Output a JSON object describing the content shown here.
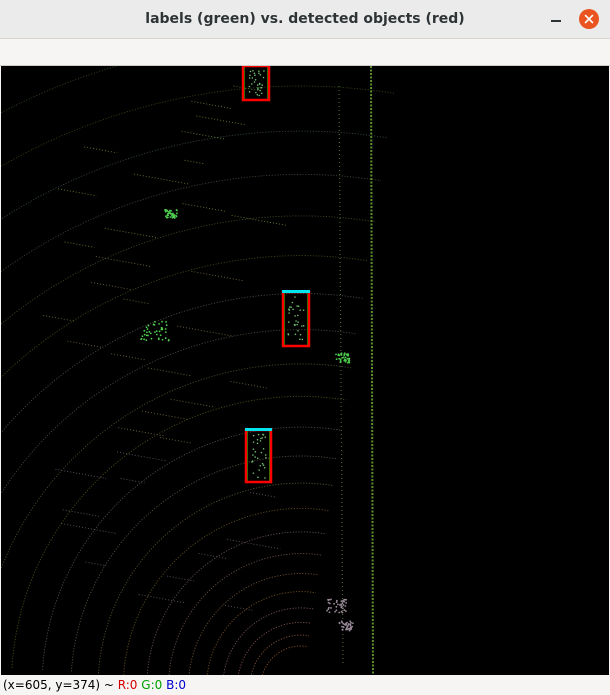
{
  "window": {
    "title": "labels (green) vs. detected objects (red)",
    "minimize_icon": "minimize-icon",
    "close_icon": "close-icon",
    "accent_close": "#e95420"
  },
  "image_view": {
    "background": "#000000",
    "colors": {
      "label_box": "#00cc00",
      "detected_box": "#ff0000",
      "heading_bar": "#00e5ee"
    }
  },
  "status": {
    "coords": "(x=605, y=374) ~ ",
    "r": "R:0",
    "g": "G:0",
    "b": "B:0"
  }
}
